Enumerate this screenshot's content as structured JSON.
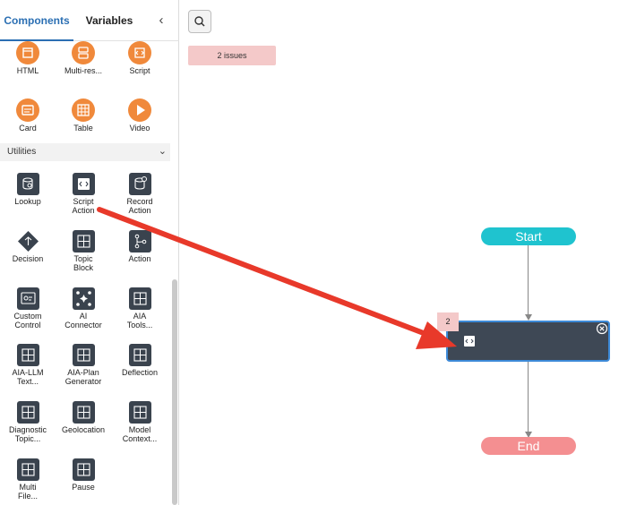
{
  "tabs": {
    "components": "Components",
    "variables": "Variables"
  },
  "collapse_icon": "chevron-left-icon",
  "palette": {
    "media_items": [
      {
        "label": "HTML",
        "icon": "html-icon"
      },
      {
        "label": "Multi-res...",
        "icon": "multi-response-icon"
      },
      {
        "label": "Script",
        "icon": "script-icon"
      },
      {
        "label": "Card",
        "icon": "card-icon"
      },
      {
        "label": "Table",
        "icon": "table-icon"
      },
      {
        "label": "Video",
        "icon": "video-icon"
      }
    ],
    "utilities_section": "Utilities",
    "utility_items": [
      {
        "label": "Lookup",
        "icon": "lookup-icon"
      },
      {
        "label": "Script\nAction",
        "icon": "script-action-icon"
      },
      {
        "label": "Record\nAction",
        "icon": "record-action-icon"
      },
      {
        "label": "Decision",
        "icon": "decision-icon"
      },
      {
        "label": "Topic\nBlock",
        "icon": "topic-block-icon"
      },
      {
        "label": "Action",
        "icon": "action-icon"
      },
      {
        "label": "Custom\nControl",
        "icon": "custom-control-icon"
      },
      {
        "label": "AI\nConnector",
        "icon": "ai-connector-icon"
      },
      {
        "label": "AIA\nTools...",
        "icon": "aia-tools-icon"
      },
      {
        "label": "AIA-LLM\nText...",
        "icon": "aia-llm-text-icon"
      },
      {
        "label": "AIA-Plan\nGenerator",
        "icon": "aia-plan-generator-icon"
      },
      {
        "label": "Deflection",
        "icon": "deflection-icon"
      },
      {
        "label": "Diagnostic\nTopic...",
        "icon": "diagnostic-topic-icon"
      },
      {
        "label": "Geolocation",
        "icon": "geolocation-icon"
      },
      {
        "label": "Model\nContext...",
        "icon": "model-context-icon"
      },
      {
        "label": "Multi\nFile...",
        "icon": "multi-file-icon"
      },
      {
        "label": "Pause",
        "icon": "pause-icon"
      }
    ]
  },
  "canvas": {
    "issues_label": "2 issues",
    "start_label": "Start",
    "end_label": "End",
    "node_issue_count": "2"
  },
  "colors": {
    "accent": "#2b6fb3",
    "orange_icon": "#f0893b",
    "dark_icon": "#3a434e",
    "start": "#1fc3cf",
    "end": "#f48f91",
    "issue_badge": "#f4c9c9",
    "node_fill": "#3e4855",
    "node_border": "#3d8ad8",
    "annotation_arrow": "#e8392a"
  }
}
